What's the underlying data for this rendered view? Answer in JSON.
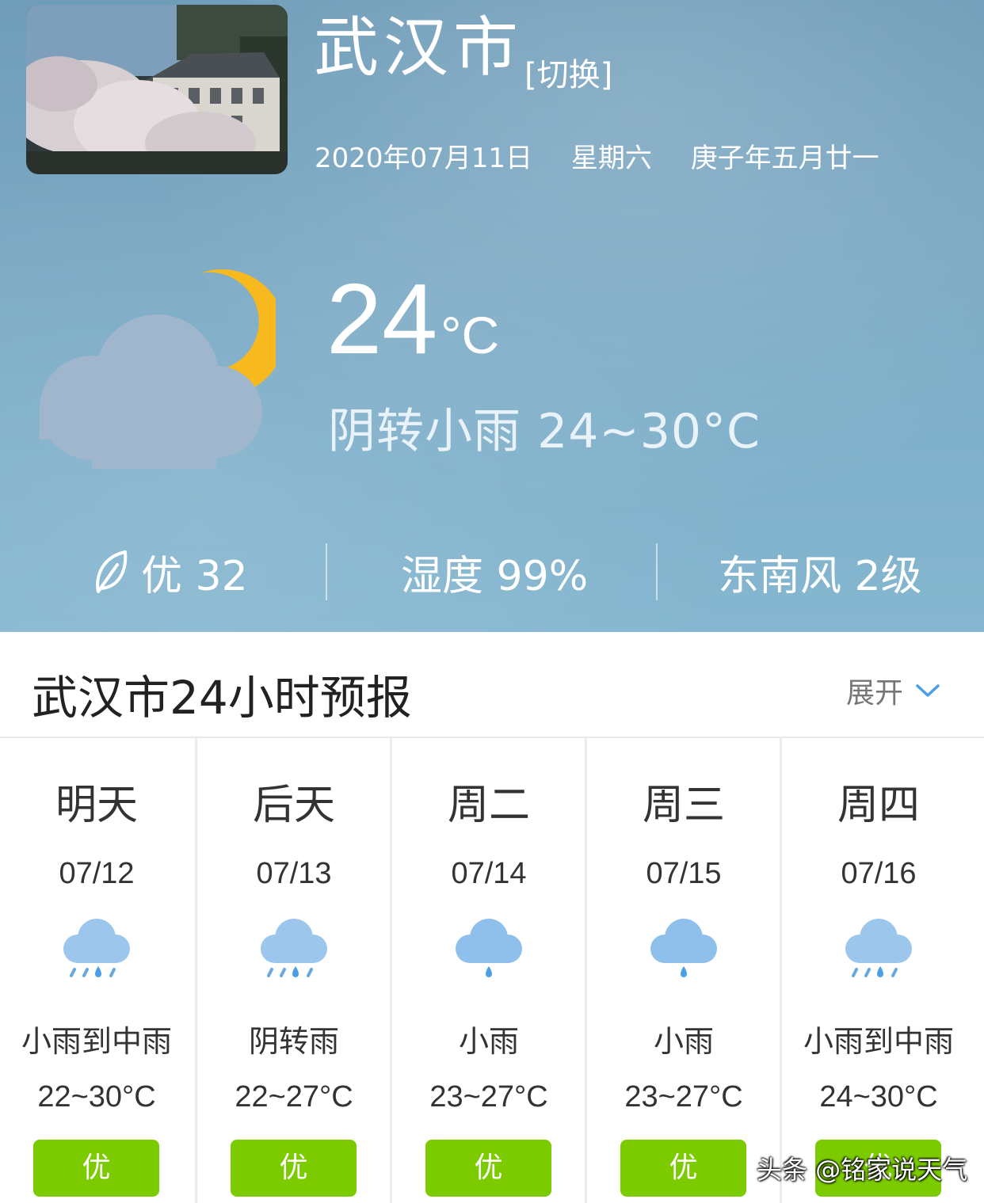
{
  "header": {
    "city": "武汉市",
    "switch_label": "[切换]",
    "date": "2020年07月11日",
    "weekday": "星期六",
    "lunar": "庚子年五月廿一"
  },
  "current": {
    "icon": "cloud-moon-icon",
    "temperature": "24",
    "unit": "°C",
    "condition": "阴转小雨 24~30°C",
    "aqi": "优 32",
    "humidity": "湿度 99%",
    "wind": "东南风 2级"
  },
  "forecast_section": {
    "title": "武汉市24小时预报",
    "expand_label": "展开"
  },
  "days": [
    {
      "name": "明天",
      "date": "07/12",
      "icon": "rain-medium-icon",
      "condition": "小雨到中雨",
      "temp": "22~30°C",
      "aqi": "优"
    },
    {
      "name": "后天",
      "date": "07/13",
      "icon": "rain-medium-icon",
      "condition": "阴转雨",
      "temp": "22~27°C",
      "aqi": "优"
    },
    {
      "name": "周二",
      "date": "07/14",
      "icon": "rain-light-icon",
      "condition": "小雨",
      "temp": "23~27°C",
      "aqi": "优"
    },
    {
      "name": "周三",
      "date": "07/15",
      "icon": "rain-light-icon",
      "condition": "小雨",
      "temp": "23~27°C",
      "aqi": "优"
    },
    {
      "name": "周四",
      "date": "07/16",
      "icon": "rain-medium-icon",
      "condition": "小雨到中雨",
      "temp": "24~30°C",
      "aqi": "优"
    }
  ],
  "colors": {
    "aqi_good": "#7ccb00",
    "moon": "#f8b91e",
    "cloud": "#9fb6cd",
    "rain_cloud": "#8fc0ec"
  },
  "watermark": "头条 @铭家说天气"
}
